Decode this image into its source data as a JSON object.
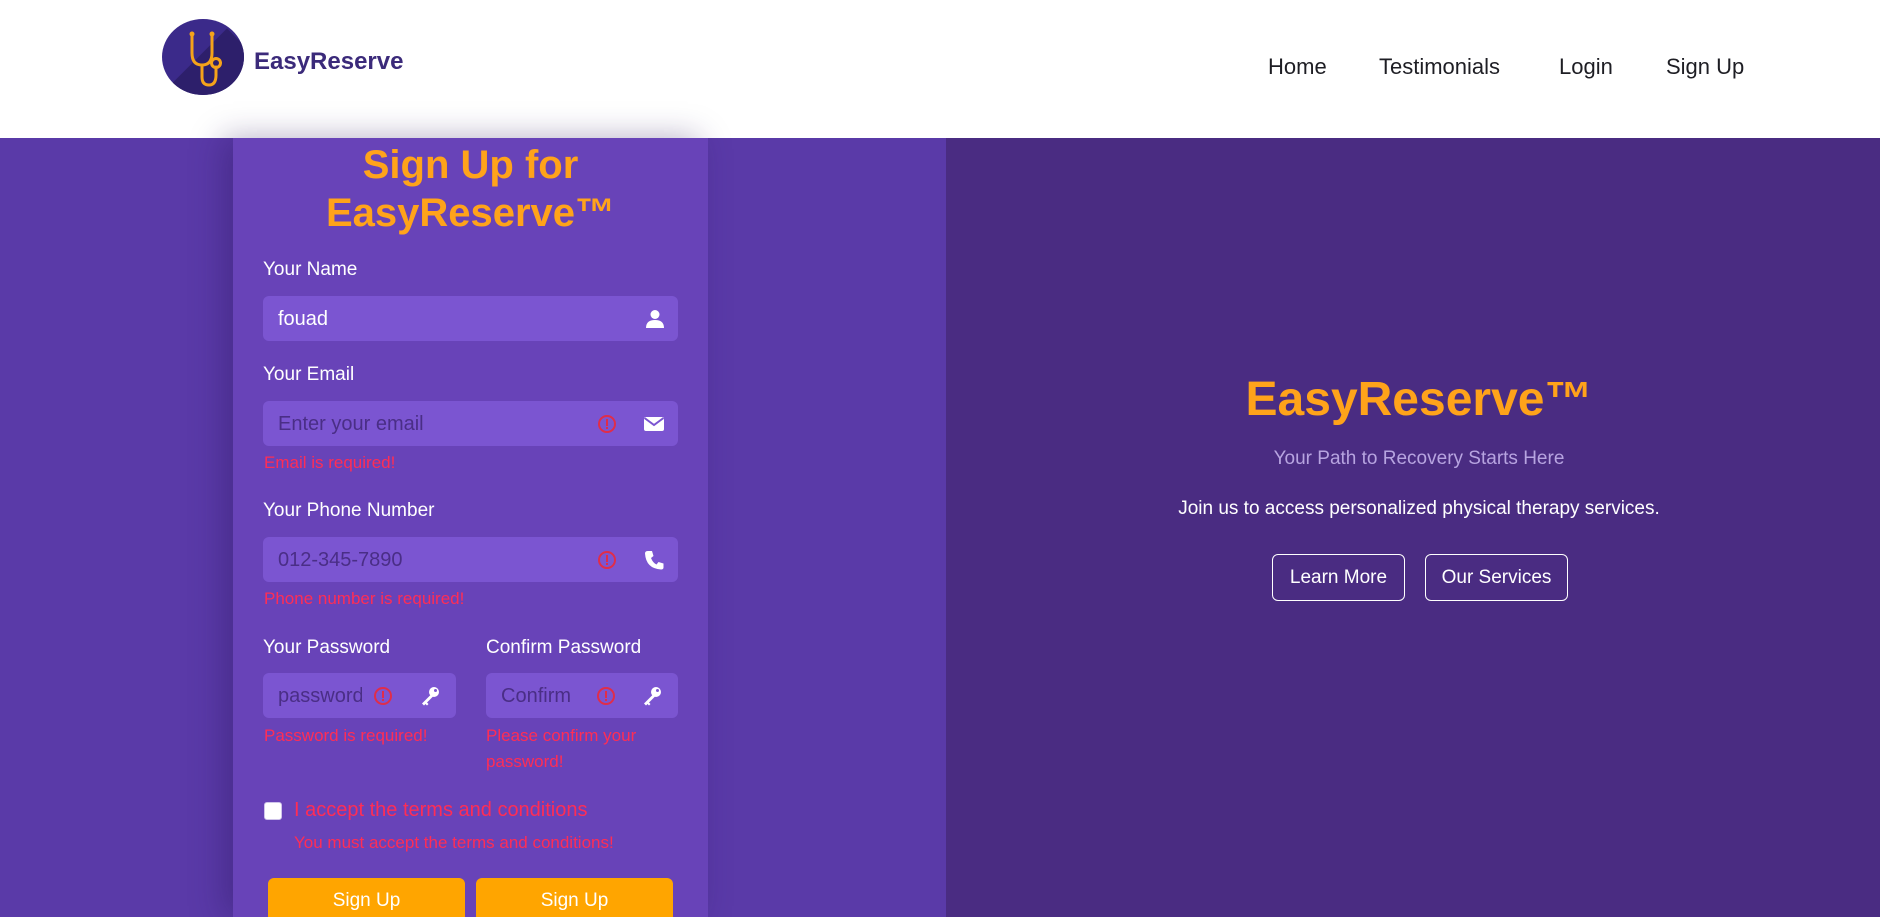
{
  "header": {
    "brand": "EasyReserve",
    "logo_icon": "stethoscope-icon",
    "nav": [
      "Home",
      "Testimonials",
      "Login",
      "Sign Up"
    ]
  },
  "form": {
    "title": "Sign Up for EasyReserve™",
    "name": {
      "label": "Your Name",
      "value": "fouad",
      "icon": "user-icon"
    },
    "email": {
      "label": "Your Email",
      "placeholder": "Enter your email",
      "error": "Email is required!",
      "icon": "envelope-icon"
    },
    "phone": {
      "label": "Your Phone Number",
      "placeholder": "012-345-7890",
      "error": "Phone number is required!",
      "icon": "phone-icon"
    },
    "password": {
      "label": "Your Password",
      "placeholder": "password",
      "error": "Password is required!",
      "icon": "key-icon"
    },
    "confirm": {
      "label": "Confirm Password",
      "placeholder": "Confirm",
      "error_line1": "Please confirm your",
      "error_line2": "password!",
      "icon": "key-icon"
    },
    "terms": {
      "label": "I accept the terms and conditions",
      "error": "You must accept the terms and conditions!",
      "checked": false
    },
    "buttons": [
      "Sign Up",
      "Sign Up"
    ]
  },
  "promo": {
    "title": "EasyReserve™",
    "subtitle": "Your Path to Recovery Starts Here",
    "text": "Join us to access personalized physical therapy services.",
    "buttons": [
      "Learn More",
      "Our Services"
    ]
  },
  "colors": {
    "accent": "#ffa31a",
    "left_bg": "#5a3aa8",
    "card_bg": "#6843b8",
    "field_bg": "#7b55d1",
    "right_bg": "#4a2c82",
    "error": "#ff2d55",
    "brand": "#3b2a7a"
  }
}
